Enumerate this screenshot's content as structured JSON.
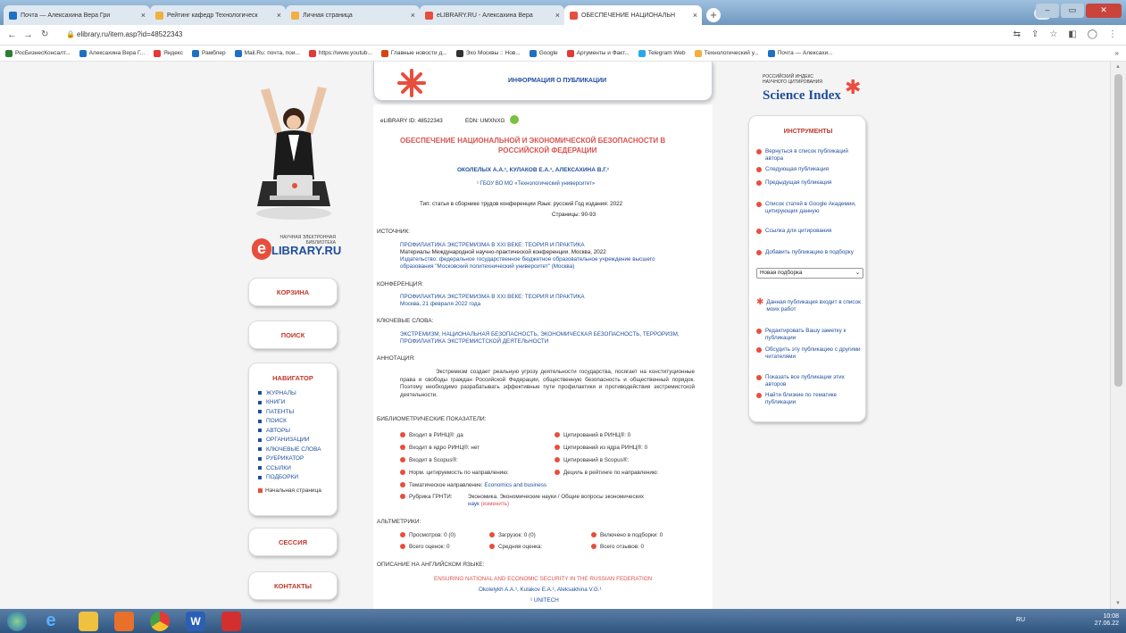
{
  "browser": {
    "tabs": [
      {
        "title": "Почта — Алексахина Вера Гри",
        "color": "#1f6fc5"
      },
      {
        "title": "Рейтинг кафедр Технологическ",
        "color": "#f0b040"
      },
      {
        "title": "Личная страница",
        "color": "#f0b040"
      },
      {
        "title": "eLIBRARY.RU - Алексахина Вера",
        "color": "#e84e3d"
      },
      {
        "title": "ОБЕСПЕЧЕНИЕ НАЦИОНАЛЬН",
        "color": "#e84e3d"
      }
    ],
    "new_tab": "+",
    "close_glyph": "×",
    "url": "elibrary.ru/item.asp?id=48522343",
    "bookmarks": [
      {
        "label": "РосБизнесКонсалт...",
        "color": "#2e7d32"
      },
      {
        "label": "Алексахина Вера Г...",
        "color": "#1f6fc5"
      },
      {
        "label": "Яндекс",
        "color": "#e53935"
      },
      {
        "label": "Рамблер",
        "color": "#1f6fc5"
      },
      {
        "label": "Mail.Ru: почта, пои...",
        "color": "#1f6fc5"
      },
      {
        "label": "https://www.youtub...",
        "color": "#e53935"
      },
      {
        "label": "Главные новости д...",
        "color": "#d84315"
      },
      {
        "label": "Эхо Москвы :: Нов...",
        "color": "#333333"
      },
      {
        "label": "Google",
        "color": "#1f6fc5"
      },
      {
        "label": "Аргументы и Факт...",
        "color": "#e53935"
      },
      {
        "label": "Telegram Web",
        "color": "#29a9eb"
      },
      {
        "label": "Технологический у...",
        "color": "#f0b040"
      },
      {
        "label": "Почта — Алексахи...",
        "color": "#1f6fc5"
      }
    ],
    "bookmarks_more": "»"
  },
  "left": {
    "logo_caption": "НАУЧНАЯ ЭЛЕКТРОННАЯ БИБЛИОТЕКА",
    "logo_e": "e",
    "logo_text": "LIBRARY.RU",
    "cart": "КОРЗИНА",
    "search": "ПОИСК",
    "navigator_title": "НАВИГАТОР",
    "nav_items": [
      "ЖУРНАЛЫ",
      "КНИГИ",
      "ПАТЕНТЫ",
      "ПОИСК",
      "АВТОРЫ",
      "ОРГАНИЗАЦИИ",
      "КЛЮЧЕВЫЕ СЛОВА",
      "РУБРИКАТОР",
      "ССЫЛКИ",
      "ПОДБОРКИ"
    ],
    "home": "Начальная страница",
    "session": "СЕССИЯ",
    "contacts": "КОНТАКТЫ"
  },
  "header": {
    "title": "ИНФОРМАЦИЯ О ПУБЛИКАЦИИ"
  },
  "pub": {
    "id_label": "eLIBRARY ID: 48522343",
    "edn_label": "EDN: UMXNXG",
    "title_line1": "ОБЕСПЕЧЕНИЕ НАЦИОНАЛЬНОЙ И ЭКОНОМИЧЕСКОЙ БЕЗОПАСНОСТИ В",
    "title_line2": "РОССИЙСКОЙ ФЕДЕРАЦИИ",
    "authors": "ОКОЛЕЛЫХ А.А.¹, КУЛАКОВ Е.А.¹, АЛЕКСАХИНА В.Г.¹",
    "affiliation": "¹ ГБОУ ВО МО «Технологический университет»",
    "type_line": "Тип: статья в сборнике трудов конференции    Язык: русский    Год издания: 2022",
    "pages": "Страницы: 90-93",
    "source_h": "ИСТОЧНИК:",
    "source_1": "ПРОФИЛАКТИКА ЭКСТРЕМИЗМА В XXI ВЕКЕ: ТЕОРИЯ И ПРАКТИКА",
    "source_2": "Материалы Международной научно-практической конференции. Москва, 2022",
    "source_3": "Издательство: федеральное государственное бюджетное образовательное учреждение высшего",
    "source_4": "образования \"Московский политехнический университет\" (Москва)",
    "conf_h": "КОНФЕРЕНЦИЯ:",
    "conf_1": "ПРОФИЛАКТИКА ЭКСТРЕМИЗМА В XXI ВЕКЕ: ТЕОРИЯ И ПРАКТИКА",
    "conf_2": "Москва, 21 февраля 2022 года",
    "kw_h": "КЛЮЧЕВЫЕ СЛОВА:",
    "kw_1": "ЭКСТРЕМИЗМ, НАЦИОНАЛЬНАЯ БЕЗОПАСНОСТЬ, ЭКОНОМИЧЕСКАЯ БЕЗОПАСНОСТЬ, ТЕРРОРИЗМ,",
    "kw_2": "ПРОФИЛАКТИКА ЭКСТРЕМИСТСКОЙ ДЕЯТЕЛЬНОСТИ",
    "ann_h": "АННОТАЦИЯ:",
    "annotation": "Экстремизм создает реальную угрозу деятельности государства, посягает на конституционные права и свободы граждан Российской Федерации, общественную безопасность и общественный порядок. Поэтому необходимо разрабатывать эффективные пути профилактики и противодействия экстремистской деятельности.",
    "biblio_h": "БИБЛИОМЕТРИЧЕСКИЕ ПОКАЗАТЕЛИ:",
    "m_rinc": "Входит в РИНЦ®: да",
    "m_cit_rinc": "Цитирований в РИНЦ®: 0",
    "m_core": "Входит в ядро РИНЦ®: нет",
    "m_cit_core": "Цитирований из ядра РИНЦ®: 0",
    "m_scopus": "Входит в Scopus®:",
    "m_cit_scopus": "Цитирований в Scopus®:",
    "m_norm": "Норм. цитируемость по направлению:",
    "m_decile": "Дециль в рейтинге по направлению:",
    "m_theme_label": "Тематическое направление:",
    "m_theme_val": "Economics and business",
    "m_grnti_label": "Рубрика ГРНТИ:",
    "m_grnti_1": "Экономика. Экономические науки / Общие вопросы экономических",
    "m_grnti_2": "наук",
    "m_grnti_change": "(изменить)",
    "alt_h": "АЛЬТМЕТРИКИ:",
    "a_views": "Просмотров: 0 (0)",
    "a_downloads": "Загрузок: 0 (0)",
    "a_included": "Включено в подборки: 0",
    "a_ratings": "Всего оценок: 0",
    "a_avg": "Средняя оценка:",
    "a_reviews": "Всего отзывов: 0",
    "en_h": "ОПИСАНИЕ НА АНГЛИЙСКОМ ЯЗЫКЕ:",
    "en_title": "ENSURING NATIONAL AND ECONOMIC SECURITY IN THE RUSSIAN FEDERATION",
    "en_authors": "Okolelykh A.A.¹, Kulakov E.A.¹, Aleksakhina V.G.¹",
    "en_aff": "¹ UNITECH"
  },
  "right": {
    "si_top": "РОССИЙСКИЙ ИНДЕКС НАУЧНОГО ЦИТИРОВАНИЯ",
    "si_title": "Science Index",
    "tools_title": "ИНСТРУМЕНТЫ",
    "t1": "Вернуться в список публикаций автора",
    "t2": "Следующая публикация",
    "t3": "Предыдущая публикация",
    "t4": "Список статей в Google Академии, цитирующих данную",
    "t5": "Ссылка для цитирования",
    "t6": "Добавить публикацию в подборку",
    "select": "Новая подборка",
    "t7": "Данная публикация входит в список моих работ",
    "t8": "Редактировать Вашу заметку к публикации",
    "t9": "Обсудить эту публикацию с другими читателями",
    "t10": "Показать все публикации этих авторов",
    "t11": "Найти близкие по тематике публикации"
  },
  "taskbar": {
    "lang": "RU",
    "time": "10:08",
    "date": "27.06.22"
  }
}
